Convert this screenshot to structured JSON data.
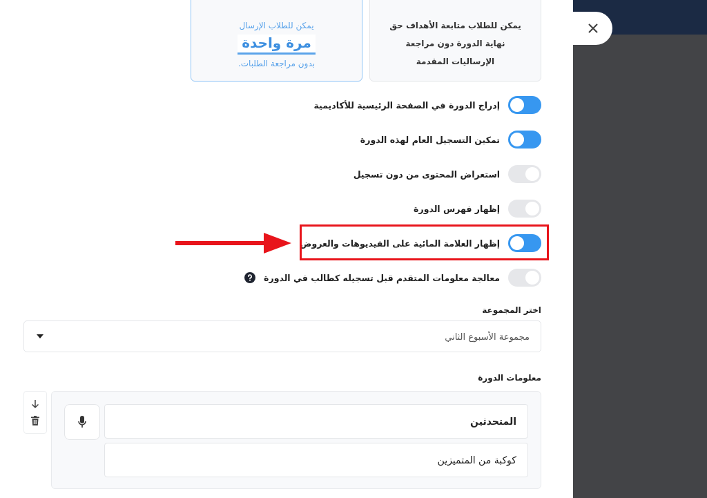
{
  "plan_cards": [
    {
      "selected": false,
      "lines": [
        "يمكن للطلاب متابعة الأهداف حق",
        "نهاية الدورة دون مراجعة",
        "الإرساليات المقدمة"
      ]
    },
    {
      "selected": true,
      "top": "يمكن للطلاب الإرسال",
      "emphasis": "مرة واحدة",
      "bottom": "بدون مراجعة الطلبات."
    }
  ],
  "settings": [
    {
      "label": "إدراج الدورة في الصفحة الرئيسية للأكاديمية",
      "on": true,
      "highlighted": false,
      "help": false
    },
    {
      "label": "تمكين التسجيل العام لهذه الدورة",
      "on": true,
      "highlighted": false,
      "help": false
    },
    {
      "label": "استعراض المحتوى من دون تسجيل",
      "on": false,
      "highlighted": false,
      "help": false
    },
    {
      "label": "إظهار فهرس الدورة",
      "on": false,
      "highlighted": false,
      "help": false
    },
    {
      "label": "إظهار العلامة المائية على الفيديوهات والعروض",
      "on": true,
      "highlighted": true,
      "help": false
    },
    {
      "label": "معالجة معلومات المتقدم قبل تسجيله كطالب في الدورة",
      "on": false,
      "highlighted": false,
      "help": true
    }
  ],
  "group_select": {
    "label": "اختر المجموعة",
    "value": "مجموعة الأسبوع الثاني"
  },
  "course_info": {
    "label": "معلومات الدورة",
    "fields": [
      "المتحدثين",
      "كوكبة من المتميزين"
    ]
  }
}
